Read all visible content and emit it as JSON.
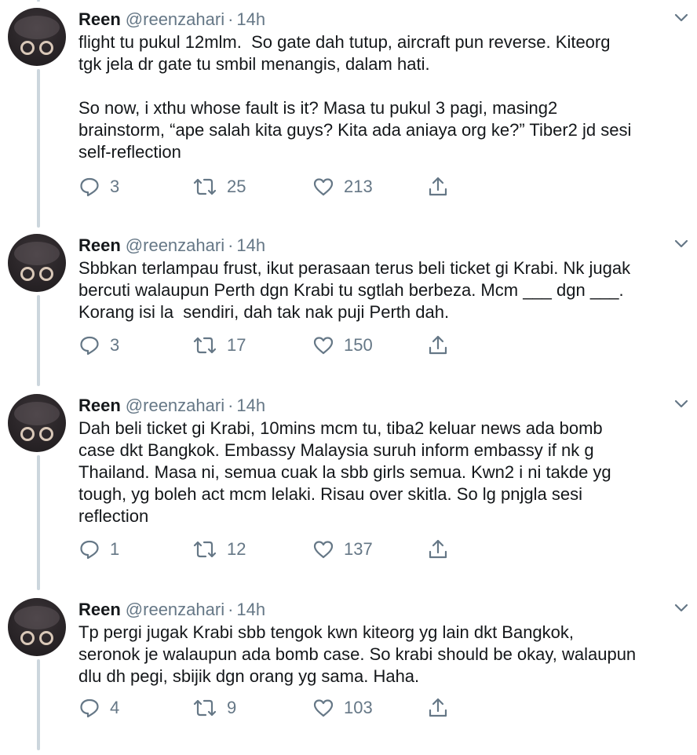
{
  "tweets": [
    {
      "name": "Reen",
      "handle": "@reenzahari",
      "separator": "·",
      "time": "14h",
      "text": "flight tu pukul 12mlm.  So gate dah tutup, aircraft pun reverse. Kiteorg\ntgk jela dr gate tu smbil menangis, dalam hati.\n\nSo now, i xthu whose fault is it? Masa tu pukul 3 pagi, masing2\nbrainstorm, “ape salah kita guys? Kita ada aniaya org ke?” Tiber2 jd sesi\nself-reflection",
      "replies": "3",
      "retweets": "25",
      "likes": "213"
    },
    {
      "name": "Reen",
      "handle": "@reenzahari",
      "separator": "·",
      "time": "14h",
      "text": "Sbbkan terlampau frust, ikut perasaan terus beli ticket gi Krabi. Nk jugak\nbercuti walaupun Perth dgn Krabi tu sgtlah berbeza. Mcm ___ dgn ___.\nKorang isi la  sendiri, dah tak nak puji Perth dah.",
      "replies": "3",
      "retweets": "17",
      "likes": "150"
    },
    {
      "name": "Reen",
      "handle": "@reenzahari",
      "separator": "·",
      "time": "14h",
      "text": "Dah beli ticket gi Krabi, 10mins mcm tu, tiba2 keluar news ada bomb\ncase dkt Bangkok. Embassy Malaysia suruh inform embassy if nk g\nThailand. Masa ni, semua cuak la sbb girls semua. Kwn2 i ni takde yg\ntough, yg boleh act mcm lelaki. Risau over skitla. So lg pnjgla sesi\nreflection",
      "replies": "1",
      "retweets": "12",
      "likes": "137"
    },
    {
      "name": "Reen",
      "handle": "@reenzahari",
      "separator": "·",
      "time": "14h",
      "text": "Tp pergi jugak Krabi sbb tengok kwn kiteorg yg lain dkt Bangkok,\nseronok je walaupun ada bomb case. So krabi should be okay, walaupun\ndlu dh pegi, sbijik dgn orang yg sama. Haha.",
      "replies": "4",
      "retweets": "9",
      "likes": "103"
    }
  ],
  "icons": {
    "reply": "reply-icon",
    "retweet": "retweet-icon",
    "like": "heart-icon",
    "share": "share-icon",
    "menu": "chevron-down-icon"
  },
  "colors": {
    "text": "#14171a",
    "muted": "#657786",
    "thread_line": "#ccd6dd"
  }
}
